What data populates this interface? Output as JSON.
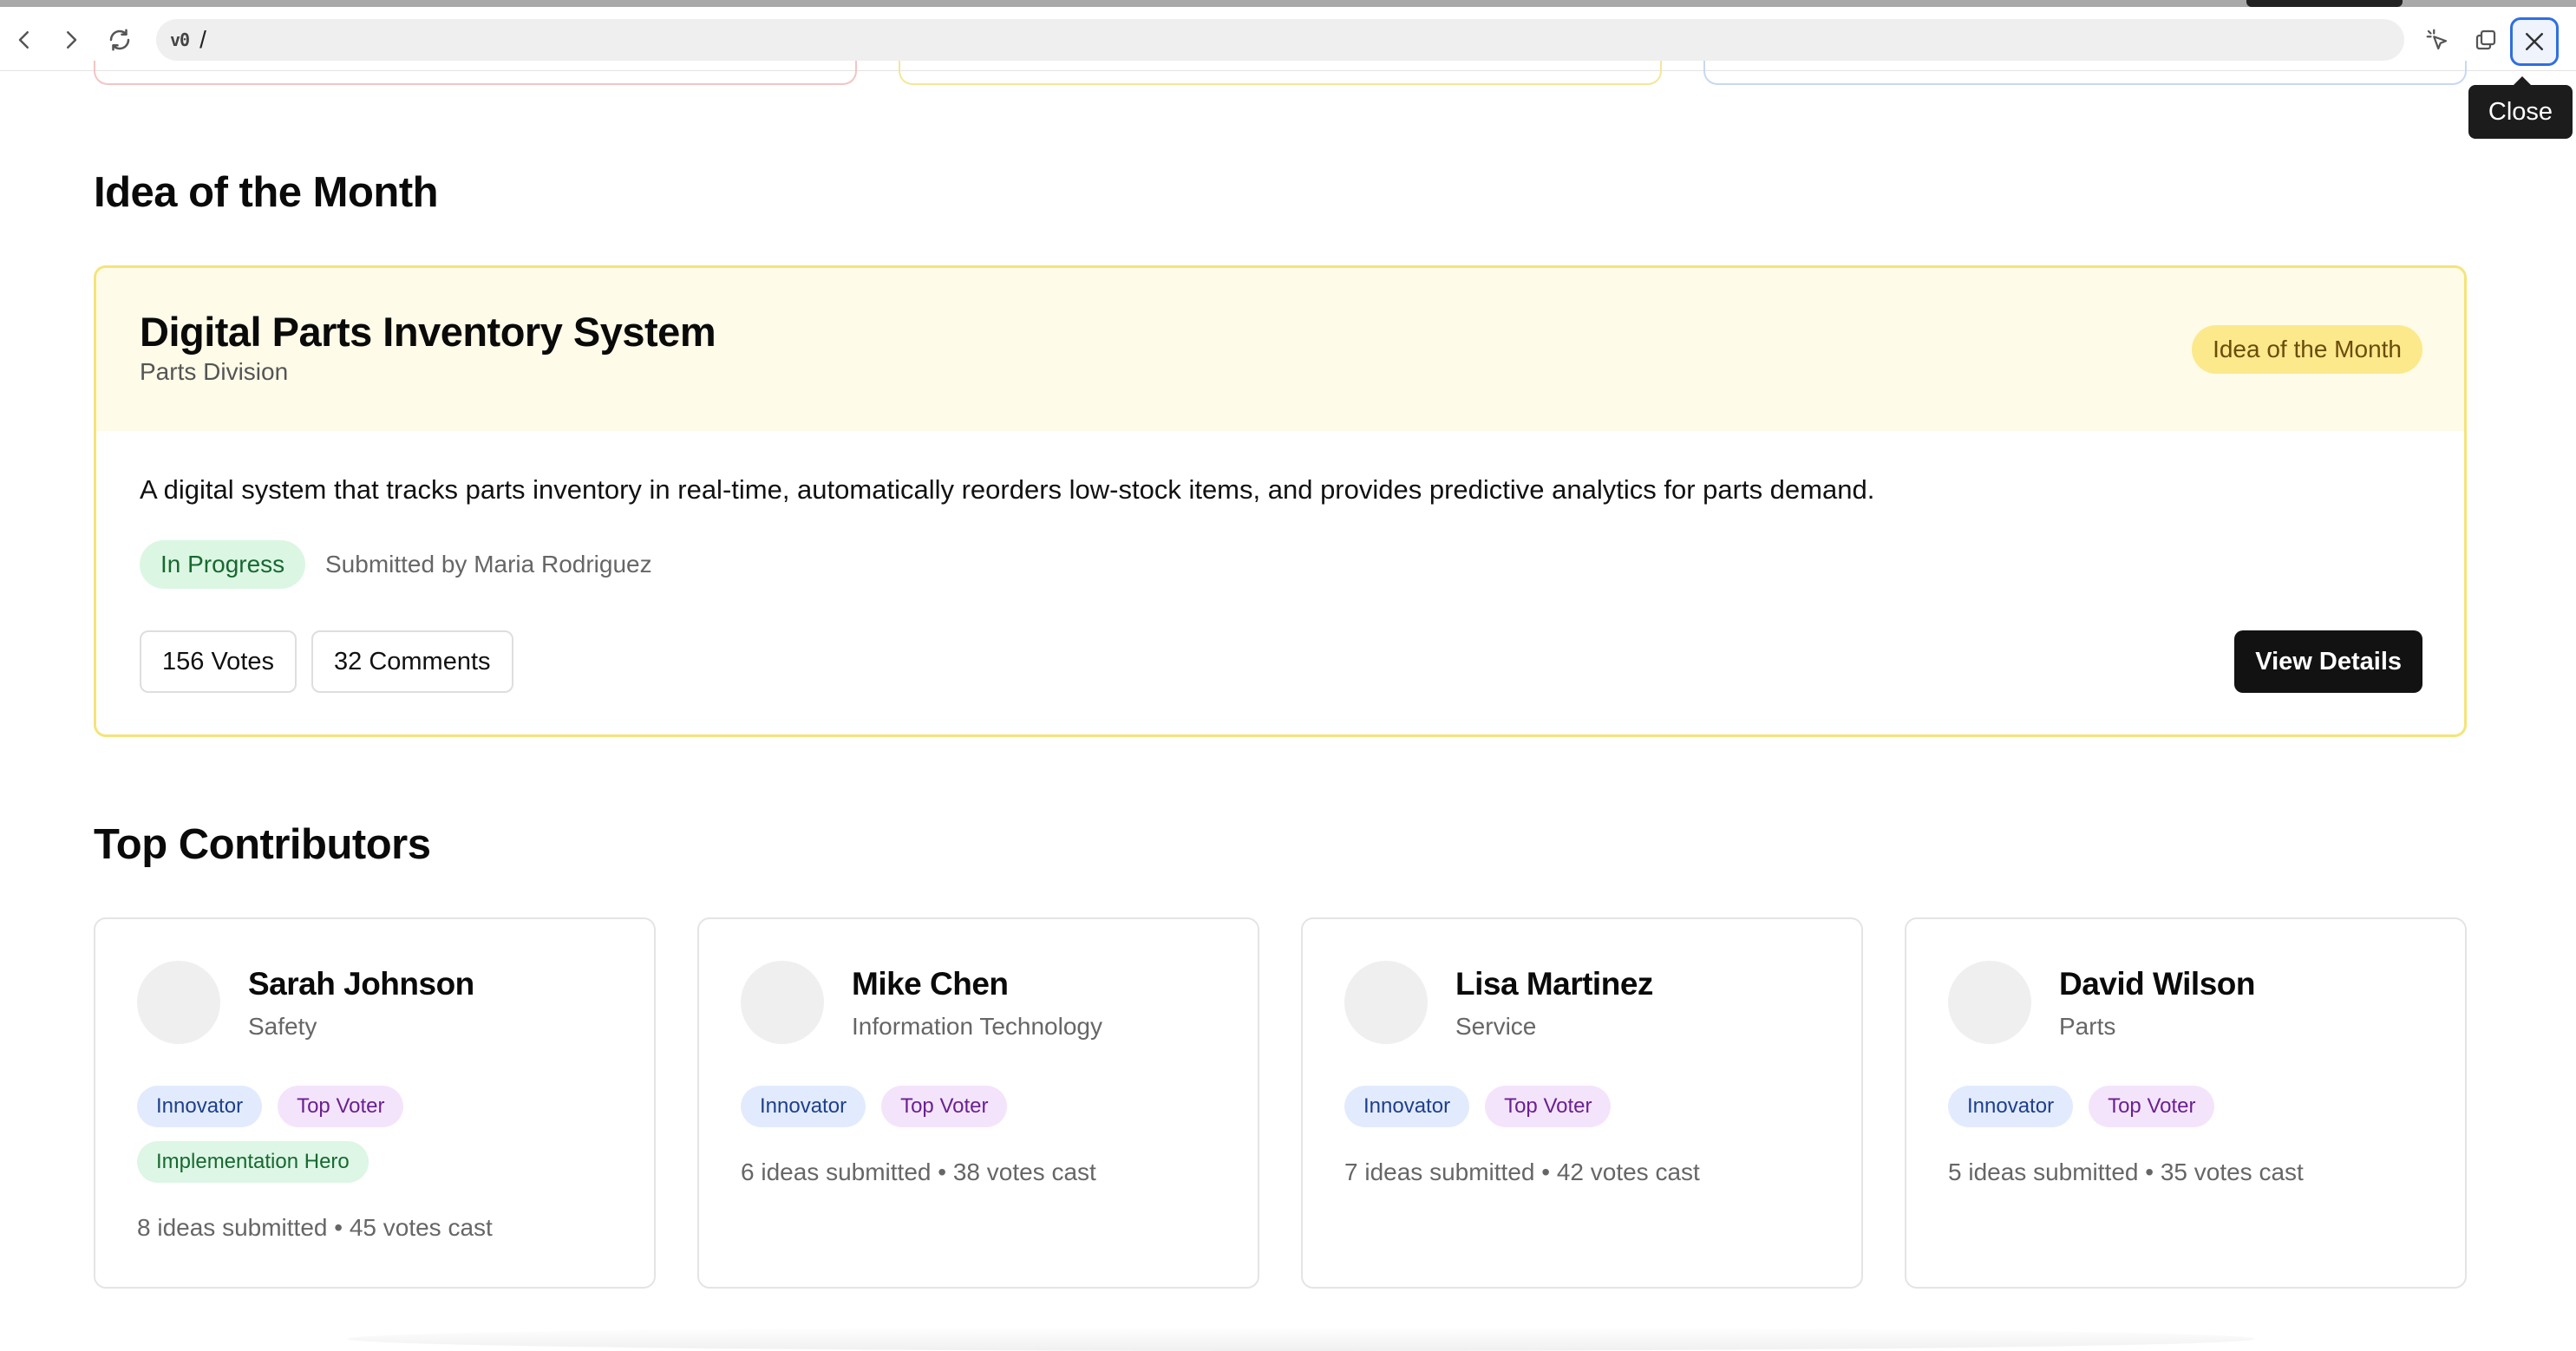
{
  "browser": {
    "address_logo": "v0",
    "address_path": "/",
    "tooltip": "Close",
    "icons": [
      "back-icon",
      "forward-icon",
      "reload-icon",
      "pointer-select-icon",
      "new-window-icon",
      "close-icon"
    ]
  },
  "idea_of_month": {
    "section_title": "Idea of the Month",
    "title": "Digital Parts Inventory System",
    "division": "Parts Division",
    "badge": "Idea of the Month",
    "description": "A digital system that tracks parts inventory in real-time, automatically reorders low-stock items, and provides predictive analytics for parts demand.",
    "status": "In Progress",
    "submitted_by": "Submitted by Maria Rodriguez",
    "votes": "156 Votes",
    "comments": "32 Comments",
    "view_details": "View Details"
  },
  "top_contributors": {
    "section_title": "Top Contributors",
    "people": [
      {
        "name": "Sarah Johnson",
        "department": "Safety",
        "badges": [
          "Innovator",
          "Top Voter",
          "Implementation Hero"
        ],
        "stats": "8 ideas submitted • 45 votes cast"
      },
      {
        "name": "Mike Chen",
        "department": "Information Technology",
        "badges": [
          "Innovator",
          "Top Voter"
        ],
        "stats": "6 ideas submitted • 38 votes cast"
      },
      {
        "name": "Lisa Martinez",
        "department": "Service",
        "badges": [
          "Innovator",
          "Top Voter"
        ],
        "stats": "7 ideas submitted • 42 votes cast"
      },
      {
        "name": "David Wilson",
        "department": "Parts",
        "badges": [
          "Innovator",
          "Top Voter"
        ],
        "stats": "5 ideas submitted • 35 votes cast"
      }
    ]
  },
  "colors": {
    "accent_close_border": "#2f6fe0",
    "idea_card_border": "#f4e47a",
    "idea_header_bg": "#fefbe8",
    "status_green": "#17692f",
    "badge_blue": "#1d3f8c",
    "badge_purple": "#6a2190",
    "primary_button": "#121212"
  }
}
